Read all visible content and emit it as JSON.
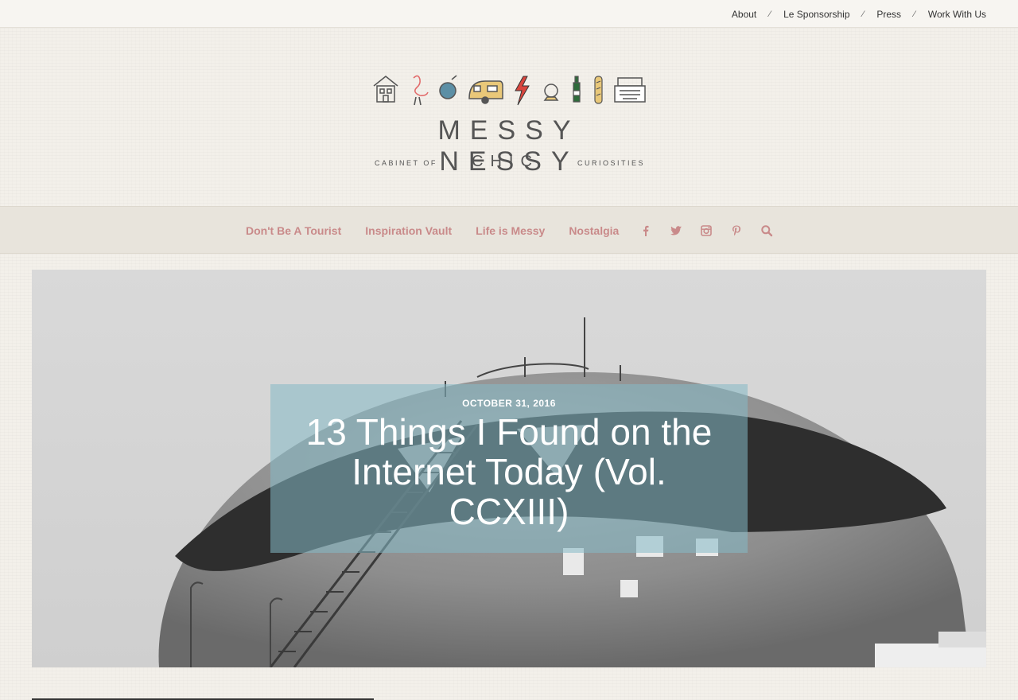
{
  "topnav": {
    "items": [
      "About",
      "Le Sponsorship",
      "Press",
      "Work With Us"
    ],
    "separator": "⁄"
  },
  "logo": {
    "title": "MESSY NESSY",
    "sub_left": "CABINET OF",
    "sub_mid": "CHIC",
    "sub_right": "CURIOSITIES"
  },
  "mainnav": {
    "items": [
      "Don't Be A Tourist",
      "Inspiration Vault",
      "Life is Messy",
      "Nostalgia"
    ],
    "icons": [
      "facebook-icon",
      "twitter-icon",
      "instagram-icon",
      "pinterest-icon",
      "search-icon"
    ],
    "link_color": "#c98a8a"
  },
  "post": {
    "date": "OCTOBER 31, 2016",
    "title": "13 Things I Found on the Internet Today (Vol. CCXIII)"
  },
  "colors": {
    "background": "#f3f0ea",
    "title_box": "#85b9c6"
  }
}
